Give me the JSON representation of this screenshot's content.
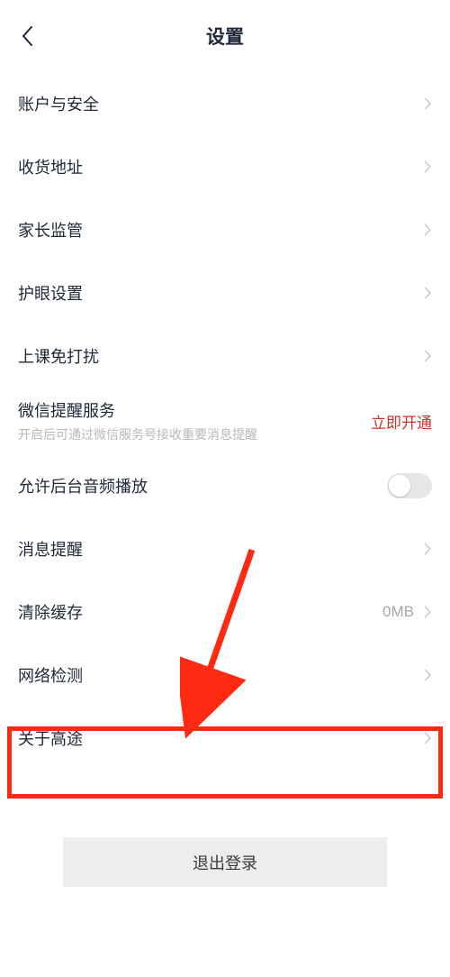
{
  "header": {
    "title": "设置"
  },
  "items": [
    {
      "label": "账户与安全"
    },
    {
      "label": "收货地址"
    },
    {
      "label": "家长监管"
    },
    {
      "label": "护眼设置"
    },
    {
      "label": "上课免打扰"
    },
    {
      "label": "微信提醒服务",
      "sub": "开启后可通过微信服务号接收重要消息提醒",
      "link": "立即开通"
    },
    {
      "label": "允许后台音频播放",
      "toggle": false
    },
    {
      "label": "消息提醒"
    },
    {
      "label": "清除缓存",
      "value": "0MB"
    },
    {
      "label": "网络检测"
    },
    {
      "label": "关于高途"
    }
  ],
  "logout": "退出登录"
}
